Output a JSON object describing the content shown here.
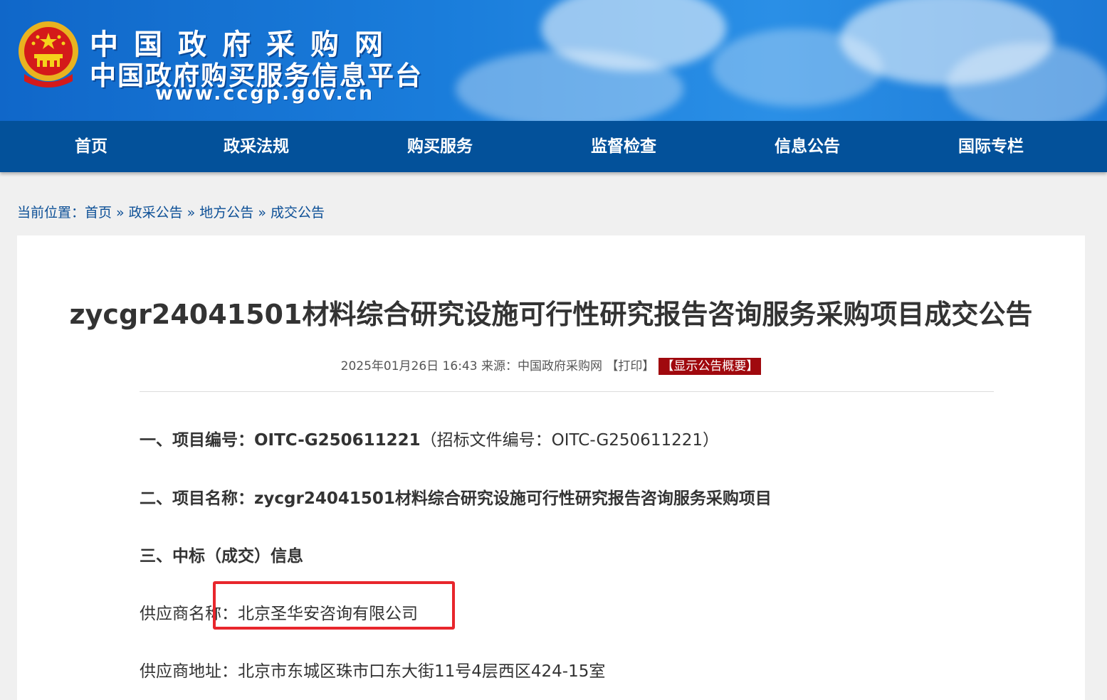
{
  "header": {
    "site_name_line1": "中国政府采购网",
    "site_name_line2": "中国政府购买服务信息平台",
    "site_url": "www.ccgp.gov.cn"
  },
  "nav": {
    "items": [
      {
        "label": "首页"
      },
      {
        "label": "政采法规"
      },
      {
        "label": "购买服务"
      },
      {
        "label": "监督检查"
      },
      {
        "label": "信息公告"
      },
      {
        "label": "国际专栏"
      }
    ]
  },
  "breadcrumb": {
    "prefix": "当前位置：",
    "items": [
      "首页",
      "政采公告",
      "地方公告",
      "成交公告"
    ],
    "separator": "»"
  },
  "article": {
    "title": "zycgr24041501材料综合研究设施可行性研究报告咨询服务采购项目成交公告",
    "meta": {
      "datetime": "2025年01月26日 16:43",
      "source_label": "来源：",
      "source": "中国政府采购网",
      "print_label": "【打印】",
      "summary_button": "【显示公告概要】"
    },
    "sections": {
      "s1_label": "一、项目编号：",
      "s1_value": "OITC-G250611221",
      "s1_note": "（招标文件编号：OITC-G250611221）",
      "s2_label": "二、项目名称：",
      "s2_value": "zycgr24041501材料综合研究设施可行性研究报告咨询服务采购项目",
      "s3_label": "三、中标（成交）信息",
      "supplier_name_label": "供应商名称：",
      "supplier_name": "北京圣华安咨询有限公司",
      "supplier_address_label": "供应商地址：",
      "supplier_address": "北京市东城区珠市口东大街11号4层西区424-15室"
    }
  },
  "colors": {
    "nav_bg": "#03519a",
    "banner_blue": "#1a7ddb",
    "summary_button_bg": "#a0090e",
    "highlight_border": "#e8262c"
  }
}
